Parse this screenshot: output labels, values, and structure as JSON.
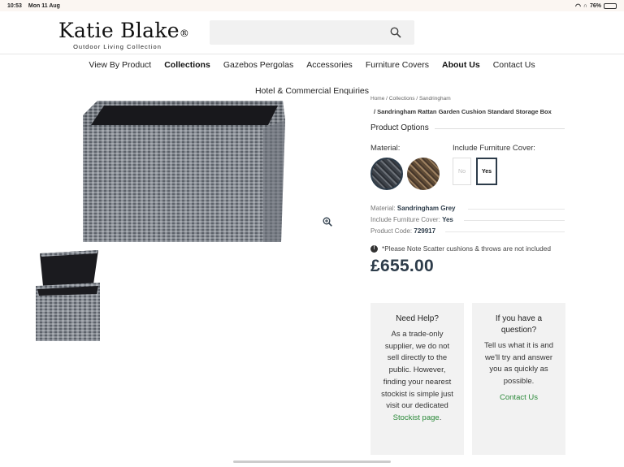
{
  "status_bar": {
    "time": "10:53",
    "date": "Mon 11 Aug",
    "battery": "76%",
    "battery_level": 0.76
  },
  "brand": {
    "name": "Katie Blake",
    "reg": "®",
    "tagline": "Outdoor Living Collection"
  },
  "search": {
    "placeholder": "",
    "icon": "search-icon"
  },
  "nav": {
    "items": [
      {
        "label": "View By Product"
      },
      {
        "label": "Collections"
      },
      {
        "label": "Gazebos Pergolas"
      },
      {
        "label": "Accessories"
      },
      {
        "label": "Furniture Covers"
      },
      {
        "label": "About Us"
      },
      {
        "label": "Contact Us"
      }
    ],
    "second_row": "Hotel & Commercial Enquiries"
  },
  "breadcrumb": {
    "part1": "Home  /  Collections  /  Sandringham",
    "current": "/  Sandringham Rattan Garden Cushion Standard Storage Box"
  },
  "product": {
    "options_title": "Product Options",
    "material_label": "Material:",
    "cover_label": "Include Furniture Cover:",
    "cover_no": "No",
    "cover_yes": "Yes",
    "meta": [
      {
        "label": "Material:",
        "value": "Sandringham Grey"
      },
      {
        "label": "Include Furniture Cover:",
        "value": "Yes"
      },
      {
        "label": "Product Code:",
        "value": "729917"
      }
    ],
    "note": "*Please Note Scatter cushions & throws are not included",
    "price": "£655.00"
  },
  "help_card": {
    "title": "Need Help?",
    "body": "As a trade-only supplier, we do not sell directly to the public. However, finding your nearest stockist is simple just visit our dedicated",
    "link": "Stockist page",
    "end": "."
  },
  "ask_card": {
    "title": "If you have a question?",
    "body": "Tell us what it is and we'll try and answer you as quickly as possible.",
    "link": "Contact Us"
  },
  "colors": {
    "accent": "#2d3c4a",
    "link_green": "#2c8a3a"
  }
}
